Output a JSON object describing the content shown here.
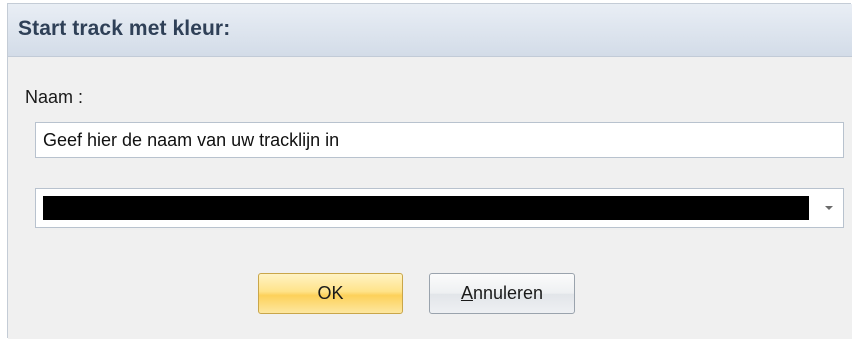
{
  "dialog": {
    "title": "Start track met kleur:"
  },
  "form": {
    "name_label": "Naam :",
    "name_value": "Geef hier de naam van uw tracklijn in",
    "color_value": "#000000"
  },
  "buttons": {
    "ok_label": "OK",
    "cancel_mnemonic": "A",
    "cancel_rest": "nnuleren"
  },
  "icons": {
    "dropdown": "chevron-down-icon"
  },
  "colors": {
    "title_text": "#2f4057",
    "ok_button": "#ffe389",
    "panel_background": "#f0f0f0"
  }
}
